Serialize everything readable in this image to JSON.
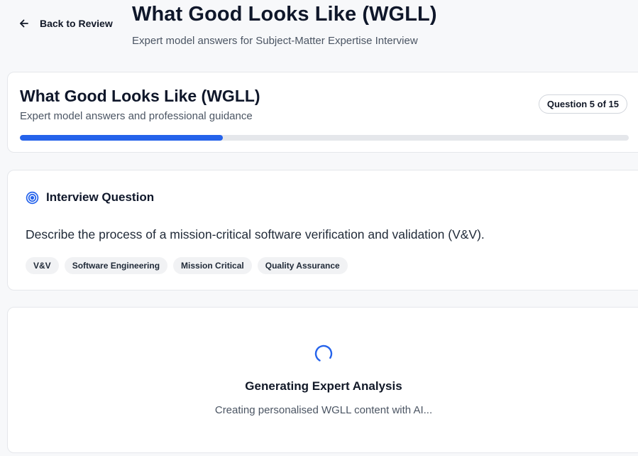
{
  "header": {
    "back_label": "Back to Review",
    "title": "What Good Looks Like (WGLL)",
    "subtitle": "Expert model answers for Subject-Matter Expertise Interview"
  },
  "progress_card": {
    "title": "What Good Looks Like (WGLL)",
    "subtitle": "Expert model answers and professional guidance",
    "question_badge": "Question 5 of 15",
    "progress_fraction": 0.333,
    "accent_color": "#2563eb"
  },
  "question_card": {
    "heading": "Interview Question",
    "icon": "target-icon",
    "question": "Describe the process of a mission-critical software verification and validation (V&V).",
    "tags": [
      "V&V",
      "Software Engineering",
      "Mission Critical",
      "Quality Assurance"
    ]
  },
  "loading_card": {
    "icon": "spinner-icon",
    "title": "Generating Expert Analysis",
    "subtitle": "Creating personalised WGLL content with AI..."
  }
}
